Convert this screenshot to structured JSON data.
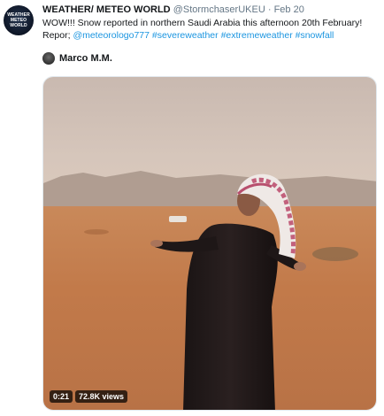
{
  "account": {
    "avatar_text": [
      "WEATHER",
      "METEO",
      "WORLD"
    ],
    "display_name": "WEATHER/ METEO WORLD",
    "handle": "@StormchaserUKEU",
    "separator": "·",
    "date": "Feb 20"
  },
  "tweet": {
    "line1": "WOW!!! Snow reported in northern Saudi Arabia this afternoon 20th February!",
    "line2_prefix": "Repor; ",
    "mention": "@meteorologo777",
    "hashtags": [
      "#severeweather",
      "#extremeweather",
      "#snowfall"
    ]
  },
  "media_credit": {
    "name": "Marco M.M."
  },
  "video": {
    "duration": "0:21",
    "views": "72.8K views"
  },
  "colors": {
    "link": "#1b95e0",
    "text": "#14171a",
    "muted": "#657786"
  }
}
